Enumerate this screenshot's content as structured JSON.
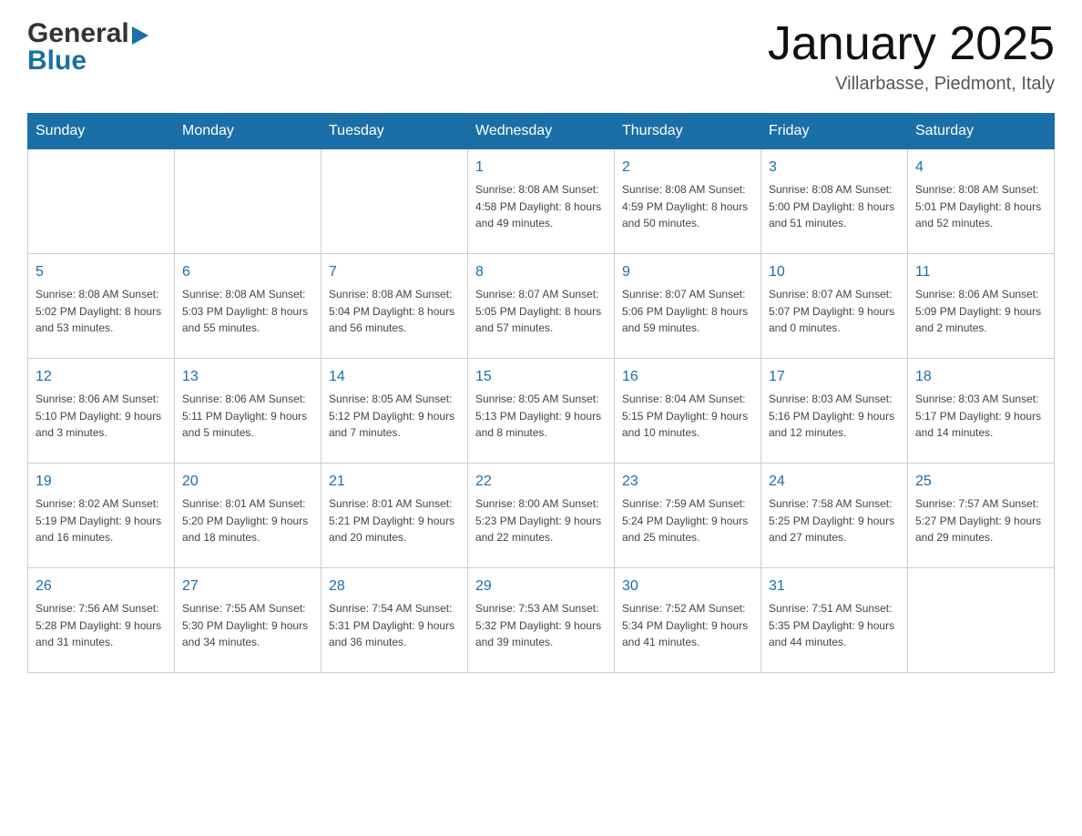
{
  "header": {
    "title": "January 2025",
    "subtitle": "Villarbasse, Piedmont, Italy",
    "logo_general": "General",
    "logo_blue": "Blue"
  },
  "days_of_week": [
    "Sunday",
    "Monday",
    "Tuesday",
    "Wednesday",
    "Thursday",
    "Friday",
    "Saturday"
  ],
  "weeks": [
    [
      {
        "day": "",
        "info": ""
      },
      {
        "day": "",
        "info": ""
      },
      {
        "day": "",
        "info": ""
      },
      {
        "day": "1",
        "info": "Sunrise: 8:08 AM\nSunset: 4:58 PM\nDaylight: 8 hours\nand 49 minutes."
      },
      {
        "day": "2",
        "info": "Sunrise: 8:08 AM\nSunset: 4:59 PM\nDaylight: 8 hours\nand 50 minutes."
      },
      {
        "day": "3",
        "info": "Sunrise: 8:08 AM\nSunset: 5:00 PM\nDaylight: 8 hours\nand 51 minutes."
      },
      {
        "day": "4",
        "info": "Sunrise: 8:08 AM\nSunset: 5:01 PM\nDaylight: 8 hours\nand 52 minutes."
      }
    ],
    [
      {
        "day": "5",
        "info": "Sunrise: 8:08 AM\nSunset: 5:02 PM\nDaylight: 8 hours\nand 53 minutes."
      },
      {
        "day": "6",
        "info": "Sunrise: 8:08 AM\nSunset: 5:03 PM\nDaylight: 8 hours\nand 55 minutes."
      },
      {
        "day": "7",
        "info": "Sunrise: 8:08 AM\nSunset: 5:04 PM\nDaylight: 8 hours\nand 56 minutes."
      },
      {
        "day": "8",
        "info": "Sunrise: 8:07 AM\nSunset: 5:05 PM\nDaylight: 8 hours\nand 57 minutes."
      },
      {
        "day": "9",
        "info": "Sunrise: 8:07 AM\nSunset: 5:06 PM\nDaylight: 8 hours\nand 59 minutes."
      },
      {
        "day": "10",
        "info": "Sunrise: 8:07 AM\nSunset: 5:07 PM\nDaylight: 9 hours\nand 0 minutes."
      },
      {
        "day": "11",
        "info": "Sunrise: 8:06 AM\nSunset: 5:09 PM\nDaylight: 9 hours\nand 2 minutes."
      }
    ],
    [
      {
        "day": "12",
        "info": "Sunrise: 8:06 AM\nSunset: 5:10 PM\nDaylight: 9 hours\nand 3 minutes."
      },
      {
        "day": "13",
        "info": "Sunrise: 8:06 AM\nSunset: 5:11 PM\nDaylight: 9 hours\nand 5 minutes."
      },
      {
        "day": "14",
        "info": "Sunrise: 8:05 AM\nSunset: 5:12 PM\nDaylight: 9 hours\nand 7 minutes."
      },
      {
        "day": "15",
        "info": "Sunrise: 8:05 AM\nSunset: 5:13 PM\nDaylight: 9 hours\nand 8 minutes."
      },
      {
        "day": "16",
        "info": "Sunrise: 8:04 AM\nSunset: 5:15 PM\nDaylight: 9 hours\nand 10 minutes."
      },
      {
        "day": "17",
        "info": "Sunrise: 8:03 AM\nSunset: 5:16 PM\nDaylight: 9 hours\nand 12 minutes."
      },
      {
        "day": "18",
        "info": "Sunrise: 8:03 AM\nSunset: 5:17 PM\nDaylight: 9 hours\nand 14 minutes."
      }
    ],
    [
      {
        "day": "19",
        "info": "Sunrise: 8:02 AM\nSunset: 5:19 PM\nDaylight: 9 hours\nand 16 minutes."
      },
      {
        "day": "20",
        "info": "Sunrise: 8:01 AM\nSunset: 5:20 PM\nDaylight: 9 hours\nand 18 minutes."
      },
      {
        "day": "21",
        "info": "Sunrise: 8:01 AM\nSunset: 5:21 PM\nDaylight: 9 hours\nand 20 minutes."
      },
      {
        "day": "22",
        "info": "Sunrise: 8:00 AM\nSunset: 5:23 PM\nDaylight: 9 hours\nand 22 minutes."
      },
      {
        "day": "23",
        "info": "Sunrise: 7:59 AM\nSunset: 5:24 PM\nDaylight: 9 hours\nand 25 minutes."
      },
      {
        "day": "24",
        "info": "Sunrise: 7:58 AM\nSunset: 5:25 PM\nDaylight: 9 hours\nand 27 minutes."
      },
      {
        "day": "25",
        "info": "Sunrise: 7:57 AM\nSunset: 5:27 PM\nDaylight: 9 hours\nand 29 minutes."
      }
    ],
    [
      {
        "day": "26",
        "info": "Sunrise: 7:56 AM\nSunset: 5:28 PM\nDaylight: 9 hours\nand 31 minutes."
      },
      {
        "day": "27",
        "info": "Sunrise: 7:55 AM\nSunset: 5:30 PM\nDaylight: 9 hours\nand 34 minutes."
      },
      {
        "day": "28",
        "info": "Sunrise: 7:54 AM\nSunset: 5:31 PM\nDaylight: 9 hours\nand 36 minutes."
      },
      {
        "day": "29",
        "info": "Sunrise: 7:53 AM\nSunset: 5:32 PM\nDaylight: 9 hours\nand 39 minutes."
      },
      {
        "day": "30",
        "info": "Sunrise: 7:52 AM\nSunset: 5:34 PM\nDaylight: 9 hours\nand 41 minutes."
      },
      {
        "day": "31",
        "info": "Sunrise: 7:51 AM\nSunset: 5:35 PM\nDaylight: 9 hours\nand 44 minutes."
      },
      {
        "day": "",
        "info": ""
      }
    ]
  ]
}
